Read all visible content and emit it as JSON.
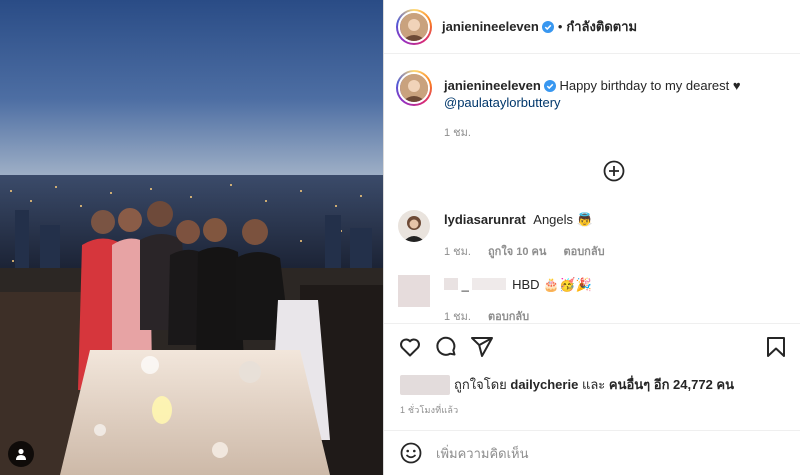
{
  "post": {
    "author": "janienineeleven",
    "separator": "•",
    "follow_label": "กำลังติดตาม",
    "caption_text": "Happy birthday to my dearest ♥",
    "caption_mention": "@paulataylorbuttery",
    "caption_time": "1 ชม."
  },
  "comments": [
    {
      "user": "lydiasarunrat",
      "text": "Angels 👼",
      "time": "1 ชม.",
      "likes": "ถูกใจ 10 คน",
      "reply": "ตอบกลับ"
    },
    {
      "user_suffix": "_",
      "text": "HBD 🎂🥳🎉",
      "time": "1 ชม.",
      "reply": "ตอบกลับ"
    }
  ],
  "likes": {
    "prefix": "ถูกใจโดย",
    "by_user": "dailycherie",
    "and": "และ",
    "others": "คนอื่นๆ อีก 24,772 คน"
  },
  "posted_ago": "1 ชั่วโมงที่แล้ว",
  "add_comment_placeholder": "เพิ่มความคิดเห็น",
  "colors": {
    "verified": "#3897f0",
    "mention": "#00376b",
    "secondary_text": "#8e8e8e"
  },
  "icons": [
    "user-tag-icon",
    "verified-badge-icon",
    "add-circle-icon",
    "heart-icon",
    "comment-icon",
    "share-icon",
    "bookmark-icon",
    "emoji-icon"
  ]
}
